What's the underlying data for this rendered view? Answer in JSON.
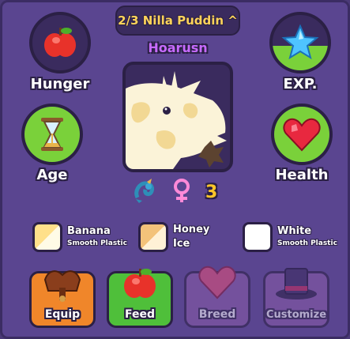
{
  "header": {
    "pet_selector": "2/3 Nilla Puddin ^",
    "pet_name": "Hoarusn"
  },
  "stats": {
    "hunger": {
      "label": "Hunger",
      "icon": "apple-icon",
      "level": 0
    },
    "exp": {
      "label": "EXP.",
      "icon": "star-icon",
      "level": 0.45
    },
    "age": {
      "label": "Age",
      "icon": "hourglass-icon",
      "level": 1.0
    },
    "health": {
      "label": "Health",
      "icon": "heart-icon",
      "level": 1.0
    }
  },
  "info": {
    "species_icon": "dragon-icon",
    "gender_icon": "female-icon",
    "age_value": "3"
  },
  "colors": [
    {
      "name": "Banana",
      "material": "Smooth Plastic",
      "primary": "#fffbe6",
      "secondary": "#ffe08a"
    },
    {
      "name": "Honey",
      "material": "Ice",
      "primary": "#fff1d6",
      "secondary": "#f3c27a"
    },
    {
      "name": "White",
      "material": "Smooth Plastic",
      "primary": "#ffffff",
      "secondary": "#ffffff"
    }
  ],
  "actions": [
    {
      "label": "Equip",
      "icon": "saddle-icon",
      "color": "#f0862a",
      "enabled": true
    },
    {
      "label": "Feed",
      "icon": "apple-icon",
      "color": "#4fbf3a",
      "enabled": true
    },
    {
      "label": "Breed",
      "icon": "heart-icon",
      "color": "#8a5ca8",
      "enabled": false
    },
    {
      "label": "Customize",
      "icon": "top-hat-icon",
      "color": "#8a5ca8",
      "enabled": false
    }
  ],
  "theme": {
    "panel": "#5a4590",
    "outline": "#2b2045",
    "stat_fill": "#7ad13a",
    "title_text": "#ffd35a",
    "name_text": "#c86bff",
    "age_text": "#ffc629"
  }
}
